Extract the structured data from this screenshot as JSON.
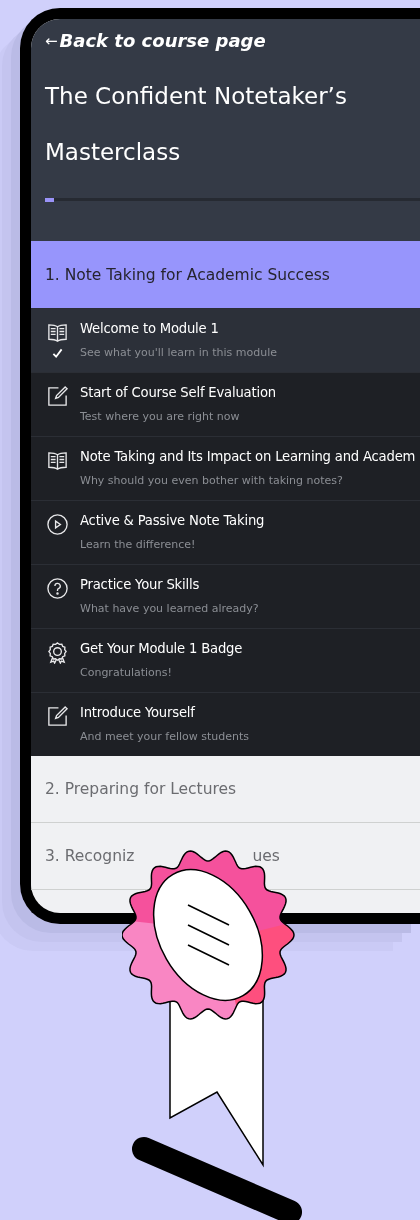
{
  "back_link": {
    "arrow": "←",
    "label": "Back to course page"
  },
  "course_title": "The Confident Notetaker’s Masterclass",
  "progress": {
    "level": 0.025
  },
  "modules": [
    {
      "title": "1. Note Taking for Academic Success",
      "expanded": true,
      "lessons": [
        {
          "kind": "reading",
          "title": "Welcome to Module 1",
          "subtitle": "See what you'll learn in this module",
          "selected": true,
          "completed": true
        },
        {
          "kind": "assignment",
          "title": "Start of Course Self Evaluation",
          "subtitle": "Test where you are right now",
          "selected": false,
          "completed": false
        },
        {
          "kind": "reading",
          "title": "Note Taking and Its Impact on Learning and Academ",
          "subtitle": "Why should you even bother with taking notes?",
          "selected": false,
          "completed": false
        },
        {
          "kind": "video",
          "title": "Active & Passive Note Taking",
          "subtitle": "Learn the difference!",
          "selected": false,
          "completed": false
        },
        {
          "kind": "quiz",
          "title": "Practice Your Skills",
          "subtitle": "What have you learned already?",
          "selected": false,
          "completed": false
        },
        {
          "kind": "badge",
          "title": "Get Your Module 1 Badge",
          "subtitle": "Congratulations!",
          "selected": false,
          "completed": false
        },
        {
          "kind": "assignment",
          "title": "Introduce Yourself",
          "subtitle": "And meet your fellow students",
          "selected": false,
          "completed": false
        }
      ]
    },
    {
      "title": "2. Preparing for Lectures",
      "expanded": false
    },
    {
      "title": "3. Recogniz",
      "title_end": "ues",
      "expanded": false
    }
  ]
}
